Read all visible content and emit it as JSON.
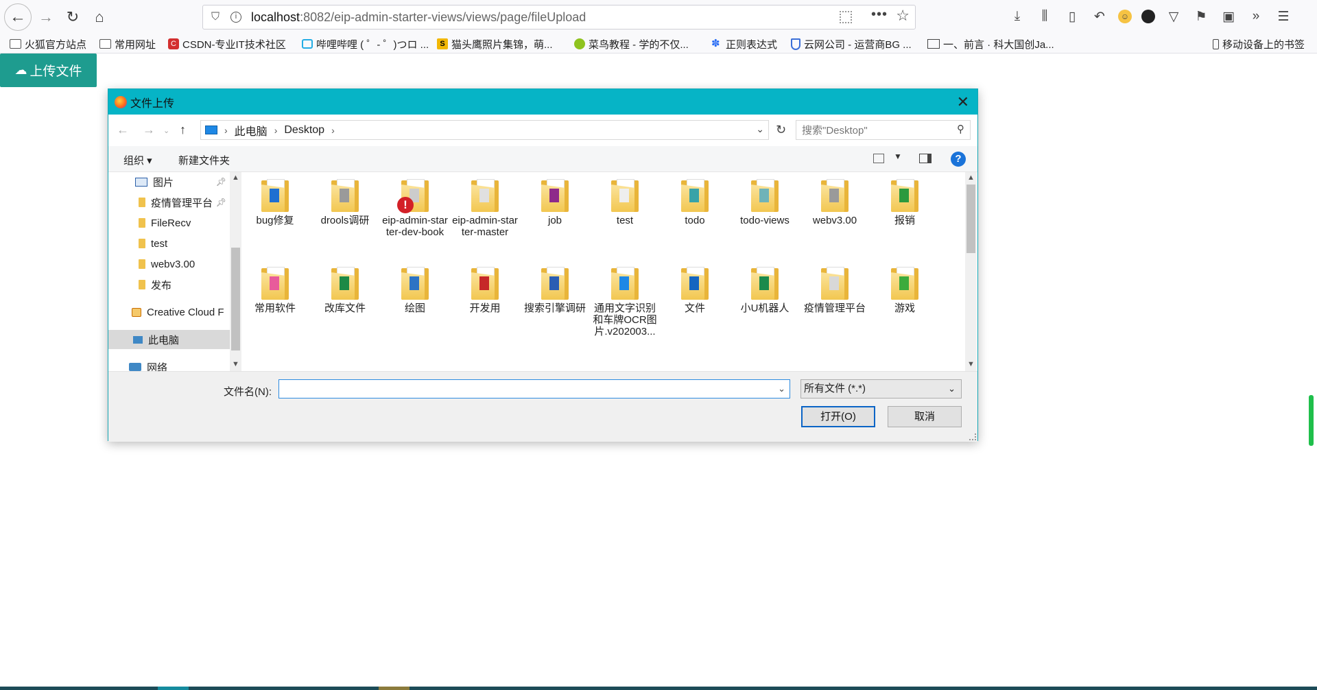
{
  "browser": {
    "url_host": "localhost",
    "url_rest": ":8082/eip-admin-starter-views/views/page/fileUpload"
  },
  "bookmarks": [
    {
      "label": "火狐官方站点",
      "icon": "folder-icon"
    },
    {
      "label": "常用网址",
      "icon": "folder-icon"
    },
    {
      "label": "CSDN-专业IT技术社区",
      "icon": "csdn-icon"
    },
    {
      "label": "哔哩哔哩 ( ゜- ゜)つロ ...",
      "icon": "bilibili-icon"
    },
    {
      "label": "猫头鹰照片集锦，萌...",
      "icon": "site-icon"
    },
    {
      "label": "菜鸟教程 - 学的不仅...",
      "icon": "runoob-icon"
    },
    {
      "label": "正则表达式",
      "icon": "paw-icon"
    },
    {
      "label": "云网公司 - 运营商BG ...",
      "icon": "shield-icon"
    },
    {
      "label": "一、前言 · 科大国创Ja...",
      "icon": "reader-icon"
    },
    {
      "label": "移动设备上的书签",
      "icon": "mobile-icon"
    }
  ],
  "page": {
    "upload_button": "上传文件"
  },
  "dialog": {
    "title": "文件上传",
    "breadcrumb": [
      "此电脑",
      "Desktop"
    ],
    "search_placeholder": "搜索\"Desktop\"",
    "organize_label": "组织 ▾",
    "new_folder_label": "新建文件夹",
    "nav_items": [
      {
        "label": "图片",
        "icon": "pictures-icon",
        "pinned": true
      },
      {
        "label": "疫情管理平台",
        "icon": "folder-icon",
        "pinned": true
      },
      {
        "label": "FileRecv",
        "icon": "folder-icon"
      },
      {
        "label": "test",
        "icon": "folder-icon"
      },
      {
        "label": "webv3.00",
        "icon": "folder-icon"
      },
      {
        "label": "发布",
        "icon": "folder-icon"
      },
      {
        "label": "Creative Cloud F",
        "icon": "creative-cloud-icon"
      },
      {
        "label": "此电脑",
        "icon": "computer-icon",
        "selected": true
      },
      {
        "label": "网络",
        "icon": "network-icon"
      }
    ],
    "files": [
      {
        "name": "bug修复",
        "decor": "#1f6fd1"
      },
      {
        "name": "drools调研",
        "decor": "#9a9a9a"
      },
      {
        "name": "eip-admin-starter-dev-book",
        "decor": "#cccccc",
        "error": true
      },
      {
        "name": "eip-admin-starter-master",
        "decor": "#e0e0e0"
      },
      {
        "name": "job",
        "decor": "#8e2a8a"
      },
      {
        "name": "test",
        "decor": "#eeeeee"
      },
      {
        "name": "todo",
        "decor": "#39a3a8"
      },
      {
        "name": "todo-views",
        "decor": "#6fb3b8"
      },
      {
        "name": "webv3.00",
        "decor": "#9a9a9a"
      },
      {
        "name": "报销",
        "decor": "#2b9a3e"
      },
      {
        "name": "常用软件",
        "decor": "#e85b9b"
      },
      {
        "name": "改库文件",
        "decor": "#1d8a46"
      },
      {
        "name": "绘图",
        "decor": "#2d73c4"
      },
      {
        "name": "开发用",
        "decor": "#c62828"
      },
      {
        "name": "搜索引擎调研",
        "decor": "#2b5db3"
      },
      {
        "name": "通用文字识别和车牌OCR图片.v202003...",
        "decor": "#1e88e5"
      },
      {
        "name": "文件",
        "decor": "#1565c0"
      },
      {
        "name": "小U机器人",
        "decor": "#1b8a4c"
      },
      {
        "name": "疫情管理平台",
        "decor": "#d8d8d8"
      },
      {
        "name": "游戏",
        "decor": "#3cab3c"
      }
    ],
    "filename_label": "文件名(N):",
    "filename_value": "",
    "filetype_value": "所有文件 (*.*)",
    "open_button": "打开(O)",
    "cancel_button": "取消"
  }
}
